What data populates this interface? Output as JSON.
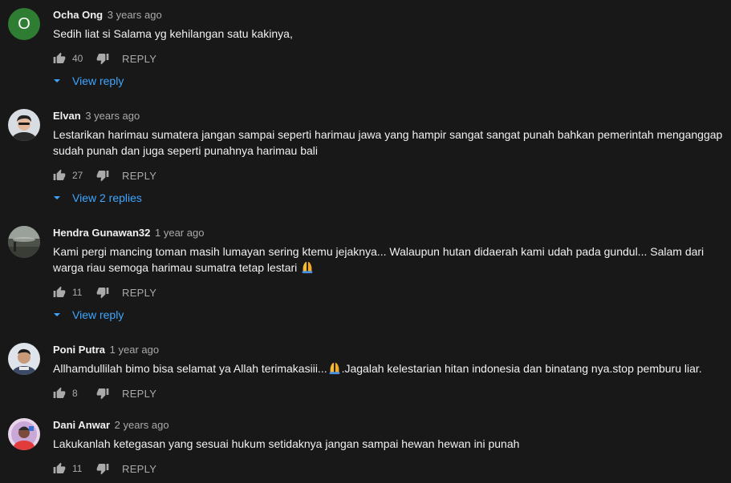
{
  "comments": [
    {
      "author": "Ocha Ong",
      "time": "3 years ago",
      "text": "Sedih liat si Salama yg kehilangan satu kakinya,",
      "likes": "40",
      "reply_label": "REPLY",
      "view_replies": "View reply",
      "avatar_letter": "O"
    },
    {
      "author": "Elvan",
      "time": "3 years ago",
      "text": "Lestarikan harimau sumatera jangan sampai seperti harimau jawa yang hampir sangat sangat punah bahkan pemerintah menganggap sudah punah dan juga seperti punahnya harimau bali",
      "likes": "27",
      "reply_label": "REPLY",
      "view_replies": "View 2 replies"
    },
    {
      "author": "Hendra Gunawan32",
      "time": "1 year ago",
      "text": "Kami pergi mancing toman masih lumayan sering ktemu jejaknya... Walaupun hutan didaerah kami udah pada gundul... Salam dari warga riau semoga harimau sumatra tetap lestari",
      "likes": "11",
      "reply_label": "REPLY",
      "view_replies": "View reply"
    },
    {
      "author": "Poni Putra",
      "time": "1 year ago",
      "text_before": "Allhamdullilah bimo bisa selamat ya Allah terimakasiii...",
      "text_after": ".Jagalah kelestarian hitan indonesia dan binatang nya.stop pemburu liar.",
      "likes": "8",
      "reply_label": "REPLY"
    },
    {
      "author": "Dani Anwar",
      "time": "2 years ago",
      "text": "Lakukanlah ketegasan yang sesuai hukum setidaknya jangan sampai hewan hewan ini punah",
      "likes": "11",
      "reply_label": "REPLY"
    }
  ],
  "colors": {
    "background": "#181818",
    "text": "#f1f1f1",
    "secondary": "#aaaaaa",
    "link": "#3ea6ff",
    "avatar_ocha": "#2e7d32"
  },
  "icons": [
    "thumbs-up-icon",
    "thumbs-down-icon",
    "caret-down-icon",
    "folded-hands-emoji"
  ]
}
